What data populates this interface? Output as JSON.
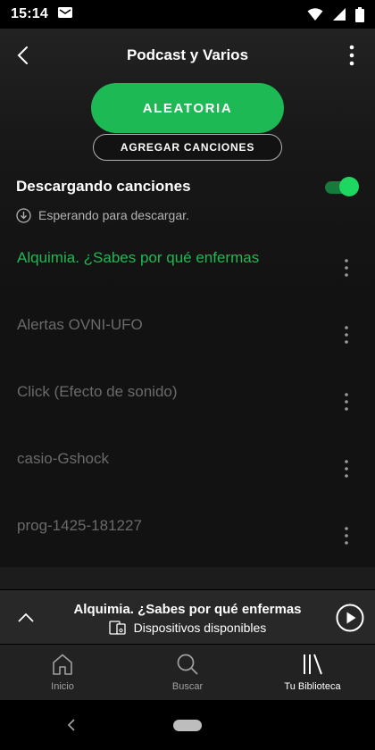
{
  "status_bar": {
    "time": "15:14"
  },
  "header": {
    "title": "Podcast y Varios"
  },
  "actions": {
    "shuffle_label": "ALEATORIA",
    "add_songs_label": "AGREGAR CANCIONES"
  },
  "download": {
    "title": "Descargando canciones",
    "enabled": true,
    "status": "Esperando para descargar."
  },
  "tracks": [
    {
      "title": "Alquimia. ¿Sabes por qué enfermas",
      "playing": true
    },
    {
      "title": "Alertas OVNI-UFO",
      "playing": false
    },
    {
      "title": "Click (Efecto de sonido)",
      "playing": false
    },
    {
      "title": "casio-Gshock",
      "playing": false
    },
    {
      "title": "prog-1425-181227",
      "playing": false
    }
  ],
  "now_playing": {
    "title": "Alquimia. ¿Sabes por qué enfermas",
    "devices_label": "Dispositivos disponibles"
  },
  "bottom_nav": [
    {
      "label": "Inicio",
      "icon": "home-icon",
      "active": false
    },
    {
      "label": "Buscar",
      "icon": "search-icon",
      "active": false
    },
    {
      "label": "Tu Biblioteca",
      "icon": "library-icon",
      "active": true
    }
  ],
  "colors": {
    "accent": "#1db954",
    "background": "#121212"
  }
}
